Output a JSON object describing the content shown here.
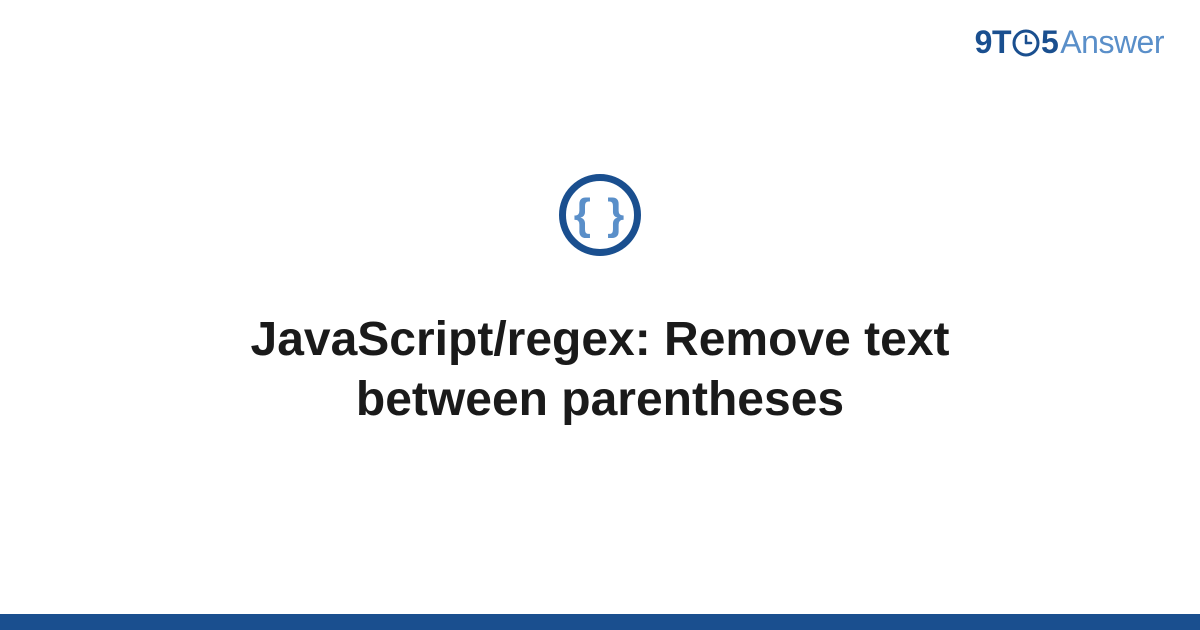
{
  "logo": {
    "part_nine": "9",
    "part_t": "T",
    "part_five": "5",
    "part_answer": "Answer"
  },
  "topic": {
    "icon_glyph": "{ }",
    "title": "JavaScript/regex: Remove text between parentheses"
  },
  "colors": {
    "primary_dark": "#1a4f8f",
    "primary_light": "#5a8fc9",
    "text": "#1a1a1a",
    "background": "#ffffff"
  }
}
